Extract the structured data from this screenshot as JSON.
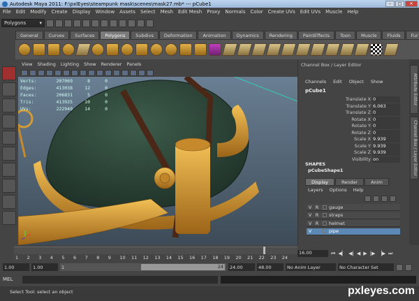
{
  "window": {
    "title": "Autodesk Maya 2011: F:\\pxlEyes\\steampunk mask\\scenes\\mask27.mb* --- pCube1"
  },
  "menubar": [
    "File",
    "Edit",
    "Modify",
    "Create",
    "Display",
    "Window",
    "Assets",
    "Select",
    "Mesh",
    "Edit Mesh",
    "Proxy",
    "Normals",
    "Color",
    "Create UVs",
    "Edit UVs",
    "Muscle",
    "Help"
  ],
  "statusline": {
    "mode": "Polygons"
  },
  "shelf_tabs": [
    "General",
    "Curves",
    "Surfaces",
    "Polygons",
    "Subdivs",
    "Deformation",
    "Animation",
    "Dynamics",
    "Rendering",
    "PaintEffects",
    "Toon",
    "Muscle",
    "Fluids",
    "Fur"
  ],
  "active_shelf_tab": "Polygons",
  "viewport_menu": [
    "View",
    "Shading",
    "Lighting",
    "Show",
    "Renderer",
    "Panels"
  ],
  "hud": [
    {
      "label": "Verts:",
      "total": "207069",
      "sel": "8",
      "tri": "0"
    },
    {
      "label": "Edges:",
      "total": "413038",
      "sel": "12",
      "tri": "0"
    },
    {
      "label": "Faces:",
      "total": "206831",
      "sel": "5",
      "tri": "0"
    },
    {
      "label": "Tris:",
      "total": "413925",
      "sel": "10",
      "tri": "0"
    },
    {
      "label": "UVs:",
      "total": "222949",
      "sel": "14",
      "tri": "0"
    }
  ],
  "channel_box": {
    "title": "Channel Box / Layer Editor",
    "menu": [
      "Channels",
      "Edit",
      "Object",
      "Show"
    ],
    "object": "pCube1",
    "attrs": [
      {
        "name": "Translate X",
        "value": "0"
      },
      {
        "name": "Translate Y",
        "value": "6.063"
      },
      {
        "name": "Translate Z",
        "value": "0"
      },
      {
        "name": "Rotate X",
        "value": "0"
      },
      {
        "name": "Rotate Y",
        "value": "0"
      },
      {
        "name": "Rotate Z",
        "value": "0"
      },
      {
        "name": "Scale X",
        "value": "9.939"
      },
      {
        "name": "Scale Y",
        "value": "9.939"
      },
      {
        "name": "Scale Z",
        "value": "9.939"
      },
      {
        "name": "Visibility",
        "value": "on"
      }
    ],
    "shapes_label": "SHAPES",
    "shape": "pCubeShape1"
  },
  "layer_editor": {
    "tabs": [
      "Display",
      "Render",
      "Anim"
    ],
    "menu": [
      "Layers",
      "Options",
      "Help"
    ],
    "layers": [
      {
        "v": "V",
        "r": "R",
        "name": "gauge",
        "selected": false
      },
      {
        "v": "V",
        "r": "R",
        "name": "straps",
        "selected": false
      },
      {
        "v": "V",
        "r": "R",
        "name": "helmet",
        "selected": false
      },
      {
        "v": "V",
        "r": "",
        "name": "pipe",
        "selected": true
      }
    ]
  },
  "side_tabs": [
    "Attribute Editor",
    "Channel Box / Layer Editor"
  ],
  "time_ticks": [
    "1",
    "2",
    "3",
    "4",
    "5",
    "6",
    "7",
    "8",
    "9",
    "10",
    "11",
    "12",
    "13",
    "14",
    "15",
    "16",
    "17",
    "18",
    "19",
    "20",
    "21",
    "22",
    "23",
    "24"
  ],
  "playback": {
    "current": "16.00"
  },
  "range": {
    "start": "1.00",
    "start2": "1.00",
    "slider_start": "1",
    "slider_end": "24",
    "end": "24.00",
    "end2": "48.00",
    "anim_layer": "No Anim Layer",
    "char_set": "No Character Set"
  },
  "mel": {
    "label": "MEL"
  },
  "help": {
    "text": "Select Tool: select an object"
  },
  "watermark": "pxleyes.com",
  "colors": {
    "shell": "#444444",
    "viewport_top": "#6a7f93",
    "brass": "#e0a23c",
    "helmet": "#2f4a3c",
    "selected_layer": "#5b88b5"
  }
}
